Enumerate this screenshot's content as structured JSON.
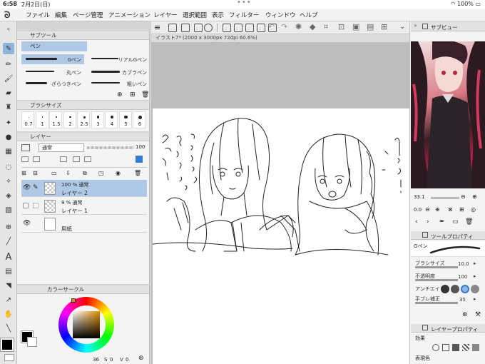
{
  "status": {
    "time": "6:58",
    "date": "2月2日(日)",
    "battery": "100%"
  },
  "menu": [
    "ファイル",
    "編集",
    "ページ管理",
    "アニメーション",
    "レイヤー",
    "選択範囲",
    "表示",
    "フィルター",
    "ウィンドウ",
    "ヘルプ"
  ],
  "subtool": {
    "title": "サブツール",
    "group": "ペン",
    "brushes": [
      "Gペン",
      "リアルGペン",
      "丸ペン",
      "カブラペン",
      "ざらつきペン",
      "粗いペン"
    ]
  },
  "brush_size": {
    "title": "ブラシサイズ",
    "sizes": [
      "0.7",
      "1",
      "1.5",
      "2",
      "2.5",
      "3",
      "4",
      "5",
      "6"
    ]
  },
  "layer_panel": {
    "title": "レイヤー",
    "blend_mode": "通常",
    "opacity_value": "100",
    "layers": [
      {
        "opacity_mode": "100 %  通常",
        "name": "レイヤー 2",
        "selected": true
      },
      {
        "opacity_mode": "9 %  通常",
        "name": "レイヤー 1",
        "selected": false
      },
      {
        "opacity_mode": "",
        "name": "用紙",
        "selected": false
      }
    ]
  },
  "color_panel": {
    "title": "カラーサークル",
    "h_val": "36",
    "s_label": "S",
    "s_val": "0",
    "v_label": "V",
    "v_val": "0"
  },
  "document": {
    "tab_title": "イラスト7* (2000 x 3000px 72dpi 60.6%)"
  },
  "subview": {
    "title": "サブビュー",
    "zoom": "33.1",
    "rotate": "0.0"
  },
  "tool_property": {
    "title": "ツールプロパティ",
    "brush_name": "Gペン",
    "rows": [
      {
        "label": "ブラシサイズ",
        "value": "10.0"
      },
      {
        "label": "不透明度",
        "value": "100"
      },
      {
        "label": "アンチエイリ",
        "value": ""
      },
      {
        "label": "手ブレ補正",
        "value": "35"
      }
    ]
  },
  "layer_property": {
    "title": "レイヤープロパティ",
    "effect_label": "効果",
    "display_color_label": "表現色"
  },
  "colors": {
    "accent": "#8fb5d9",
    "selected_row": "#aec8e6",
    "panel_bg": "#f4f4f4"
  }
}
